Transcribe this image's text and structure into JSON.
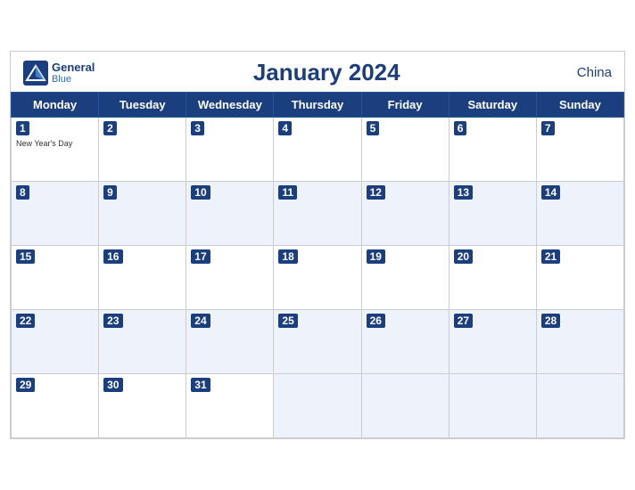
{
  "header": {
    "logo_line1": "General",
    "logo_line2": "Blue",
    "title": "January 2024",
    "country": "China"
  },
  "weekdays": [
    "Monday",
    "Tuesday",
    "Wednesday",
    "Thursday",
    "Friday",
    "Saturday",
    "Sunday"
  ],
  "weeks": [
    [
      {
        "day": 1,
        "holiday": "New Year's Day"
      },
      {
        "day": 2
      },
      {
        "day": 3
      },
      {
        "day": 4
      },
      {
        "day": 5
      },
      {
        "day": 6
      },
      {
        "day": 7
      }
    ],
    [
      {
        "day": 8
      },
      {
        "day": 9
      },
      {
        "day": 10
      },
      {
        "day": 11
      },
      {
        "day": 12
      },
      {
        "day": 13
      },
      {
        "day": 14
      }
    ],
    [
      {
        "day": 15
      },
      {
        "day": 16
      },
      {
        "day": 17
      },
      {
        "day": 18
      },
      {
        "day": 19
      },
      {
        "day": 20
      },
      {
        "day": 21
      }
    ],
    [
      {
        "day": 22
      },
      {
        "day": 23
      },
      {
        "day": 24
      },
      {
        "day": 25
      },
      {
        "day": 26
      },
      {
        "day": 27
      },
      {
        "day": 28
      }
    ],
    [
      {
        "day": 29
      },
      {
        "day": 30
      },
      {
        "day": 31
      },
      {
        "day": null
      },
      {
        "day": null
      },
      {
        "day": null
      },
      {
        "day": null
      }
    ]
  ]
}
